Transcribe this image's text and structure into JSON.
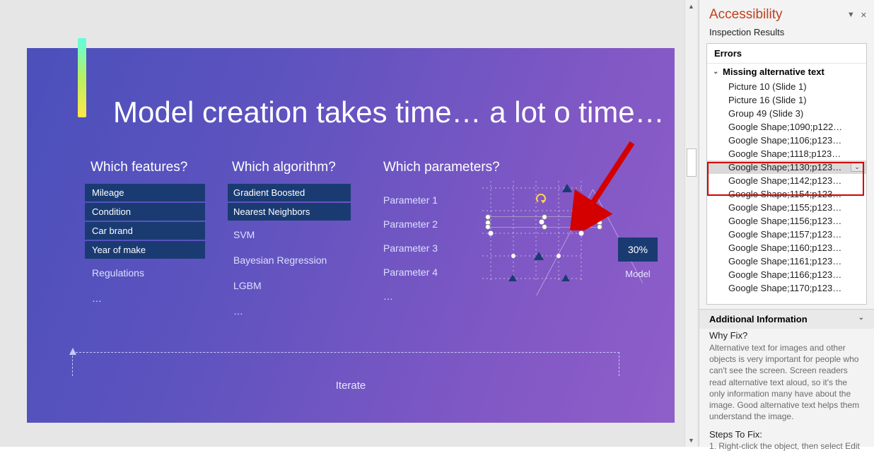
{
  "pane": {
    "title": "Accessibility",
    "subheader": "Inspection Results",
    "errors_label": "Errors",
    "category_label": "Missing alternative text",
    "items": [
      "Picture 10  (Slide 1)",
      "Picture 16  (Slide 1)",
      "Group 49  (Slide 3)",
      "Google Shape;1090;p122…",
      "Google Shape;1106;p123…",
      "Google Shape;1118;p123…",
      "Google Shape;1130;p123…",
      "Google Shape;1142;p123…",
      "Google Shape;1154;p123…",
      "Google Shape;1155;p123…",
      "Google Shape;1156;p123…",
      "Google Shape;1157;p123…",
      "Google Shape;1160;p123…",
      "Google Shape;1161;p123…",
      "Google Shape;1166;p123…",
      "Google Shape;1170;p123…"
    ],
    "selected_index": 6,
    "additional_info": "Additional Information",
    "why_fix_label": "Why Fix?",
    "why_fix_body": "Alternative text for images and other objects is very important for people who can't see the screen. Screen readers read alternative text aloud, so it's the only information many have about the image. Good alternative text helps them understand the image.",
    "steps_label": "Steps To Fix:",
    "steps_1": "1. Right-click the object, then select Edit"
  },
  "slide": {
    "title": "Model creation takes time… a lot o time…",
    "headings": {
      "features": "Which features?",
      "algorithm": "Which algorithm?",
      "parameters": "Which parameters?"
    },
    "features_boxed": [
      "Mileage",
      "Condition",
      "Car brand",
      "Year of make"
    ],
    "features_plain": [
      "Regulations",
      "…"
    ],
    "algorithms_boxed": [
      "Gradient Boosted",
      "Nearest Neighbors"
    ],
    "algorithms_plain": [
      "SVM",
      "Bayesian Regression",
      "LGBM",
      "…"
    ],
    "parameters": [
      "Parameter 1",
      "Parameter 2",
      "Parameter 3",
      "Parameter 4",
      "…"
    ],
    "iterate_label": "Iterate",
    "model_pct": "30%",
    "model_label": "Model"
  }
}
